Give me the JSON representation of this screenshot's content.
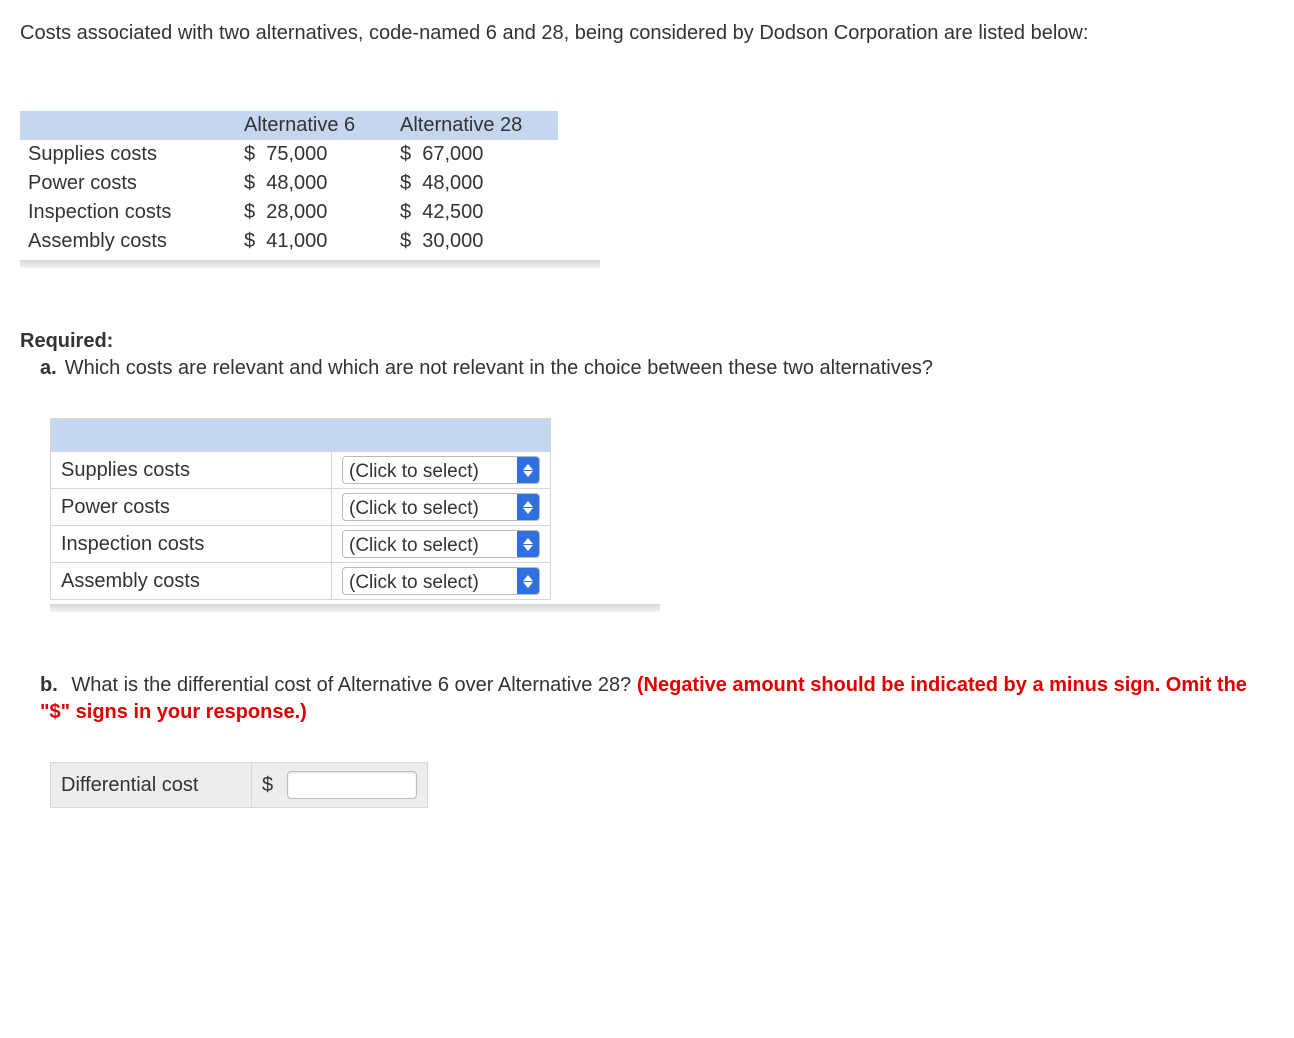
{
  "intro": "Costs associated with two alternatives, code-named 6 and 28, being considered by Dodson Corporation are listed below:",
  "costs_table": {
    "headers": [
      "",
      "Alternative 6",
      "Alternative 28"
    ],
    "rows": [
      {
        "label": "Supplies costs",
        "a6_sym": "$",
        "a6": "75,000",
        "a28_sym": "$",
        "a28": "67,000"
      },
      {
        "label": "Power costs",
        "a6_sym": "$",
        "a6": "48,000",
        "a28_sym": "$",
        "a28": "48,000"
      },
      {
        "label": "Inspection costs",
        "a6_sym": "$",
        "a6": "28,000",
        "a28_sym": "$",
        "a28": "42,500"
      },
      {
        "label": "Assembly costs",
        "a6_sym": "$",
        "a6": "41,000",
        "a28_sym": "$",
        "a28": "30,000"
      }
    ]
  },
  "required_label": "Required:",
  "question_a": "Which costs are relevant and which are not relevant in the choice between these two alternatives?",
  "select_rows": [
    {
      "label": "Supplies costs",
      "placeholder": "(Click to select)"
    },
    {
      "label": "Power costs",
      "placeholder": "(Click to select)"
    },
    {
      "label": "Inspection costs",
      "placeholder": "(Click to select)"
    },
    {
      "label": "Assembly costs",
      "placeholder": "(Click to select)"
    }
  ],
  "question_b": {
    "text": "What is the differential cost of Alternative 6 over Alternative 28? ",
    "hint": "(Negative amount should be indicated by a minus sign. Omit the \"$\" signs in your response.)"
  },
  "diff_table": {
    "label": "Differential cost",
    "symbol": "$"
  }
}
